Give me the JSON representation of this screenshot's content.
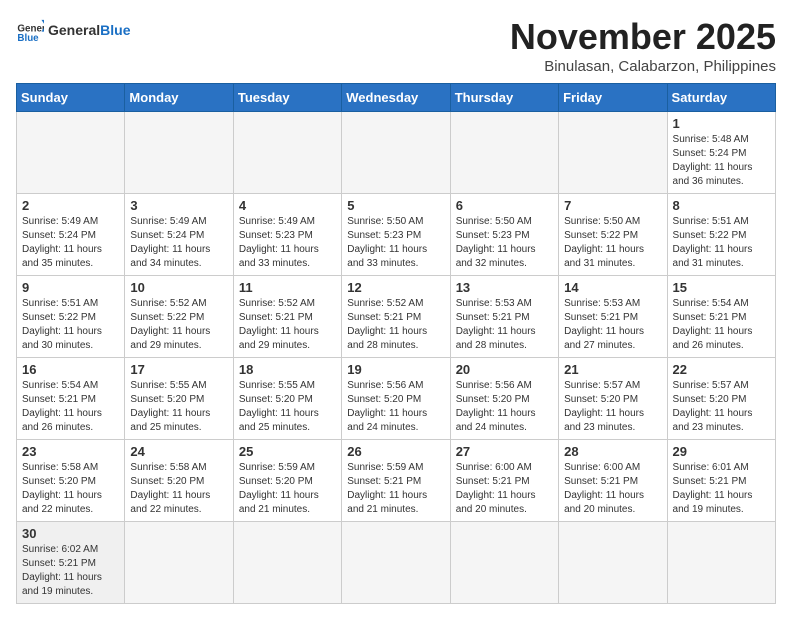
{
  "header": {
    "logo_general": "General",
    "logo_blue": "Blue",
    "month_title": "November 2025",
    "location": "Binulasan, Calabarzon, Philippines"
  },
  "weekdays": [
    "Sunday",
    "Monday",
    "Tuesday",
    "Wednesday",
    "Thursday",
    "Friday",
    "Saturday"
  ],
  "weeks": [
    [
      {
        "day": "",
        "info": ""
      },
      {
        "day": "",
        "info": ""
      },
      {
        "day": "",
        "info": ""
      },
      {
        "day": "",
        "info": ""
      },
      {
        "day": "",
        "info": ""
      },
      {
        "day": "",
        "info": ""
      },
      {
        "day": "1",
        "info": "Sunrise: 5:48 AM\nSunset: 5:24 PM\nDaylight: 11 hours\nand 36 minutes."
      }
    ],
    [
      {
        "day": "2",
        "info": "Sunrise: 5:49 AM\nSunset: 5:24 PM\nDaylight: 11 hours\nand 35 minutes."
      },
      {
        "day": "3",
        "info": "Sunrise: 5:49 AM\nSunset: 5:24 PM\nDaylight: 11 hours\nand 34 minutes."
      },
      {
        "day": "4",
        "info": "Sunrise: 5:49 AM\nSunset: 5:23 PM\nDaylight: 11 hours\nand 33 minutes."
      },
      {
        "day": "5",
        "info": "Sunrise: 5:50 AM\nSunset: 5:23 PM\nDaylight: 11 hours\nand 33 minutes."
      },
      {
        "day": "6",
        "info": "Sunrise: 5:50 AM\nSunset: 5:23 PM\nDaylight: 11 hours\nand 32 minutes."
      },
      {
        "day": "7",
        "info": "Sunrise: 5:50 AM\nSunset: 5:22 PM\nDaylight: 11 hours\nand 31 minutes."
      },
      {
        "day": "8",
        "info": "Sunrise: 5:51 AM\nSunset: 5:22 PM\nDaylight: 11 hours\nand 31 minutes."
      }
    ],
    [
      {
        "day": "9",
        "info": "Sunrise: 5:51 AM\nSunset: 5:22 PM\nDaylight: 11 hours\nand 30 minutes."
      },
      {
        "day": "10",
        "info": "Sunrise: 5:52 AM\nSunset: 5:22 PM\nDaylight: 11 hours\nand 29 minutes."
      },
      {
        "day": "11",
        "info": "Sunrise: 5:52 AM\nSunset: 5:21 PM\nDaylight: 11 hours\nand 29 minutes."
      },
      {
        "day": "12",
        "info": "Sunrise: 5:52 AM\nSunset: 5:21 PM\nDaylight: 11 hours\nand 28 minutes."
      },
      {
        "day": "13",
        "info": "Sunrise: 5:53 AM\nSunset: 5:21 PM\nDaylight: 11 hours\nand 28 minutes."
      },
      {
        "day": "14",
        "info": "Sunrise: 5:53 AM\nSunset: 5:21 PM\nDaylight: 11 hours\nand 27 minutes."
      },
      {
        "day": "15",
        "info": "Sunrise: 5:54 AM\nSunset: 5:21 PM\nDaylight: 11 hours\nand 26 minutes."
      }
    ],
    [
      {
        "day": "16",
        "info": "Sunrise: 5:54 AM\nSunset: 5:21 PM\nDaylight: 11 hours\nand 26 minutes."
      },
      {
        "day": "17",
        "info": "Sunrise: 5:55 AM\nSunset: 5:20 PM\nDaylight: 11 hours\nand 25 minutes."
      },
      {
        "day": "18",
        "info": "Sunrise: 5:55 AM\nSunset: 5:20 PM\nDaylight: 11 hours\nand 25 minutes."
      },
      {
        "day": "19",
        "info": "Sunrise: 5:56 AM\nSunset: 5:20 PM\nDaylight: 11 hours\nand 24 minutes."
      },
      {
        "day": "20",
        "info": "Sunrise: 5:56 AM\nSunset: 5:20 PM\nDaylight: 11 hours\nand 24 minutes."
      },
      {
        "day": "21",
        "info": "Sunrise: 5:57 AM\nSunset: 5:20 PM\nDaylight: 11 hours\nand 23 minutes."
      },
      {
        "day": "22",
        "info": "Sunrise: 5:57 AM\nSunset: 5:20 PM\nDaylight: 11 hours\nand 23 minutes."
      }
    ],
    [
      {
        "day": "23",
        "info": "Sunrise: 5:58 AM\nSunset: 5:20 PM\nDaylight: 11 hours\nand 22 minutes."
      },
      {
        "day": "24",
        "info": "Sunrise: 5:58 AM\nSunset: 5:20 PM\nDaylight: 11 hours\nand 22 minutes."
      },
      {
        "day": "25",
        "info": "Sunrise: 5:59 AM\nSunset: 5:20 PM\nDaylight: 11 hours\nand 21 minutes."
      },
      {
        "day": "26",
        "info": "Sunrise: 5:59 AM\nSunset: 5:21 PM\nDaylight: 11 hours\nand 21 minutes."
      },
      {
        "day": "27",
        "info": "Sunrise: 6:00 AM\nSunset: 5:21 PM\nDaylight: 11 hours\nand 20 minutes."
      },
      {
        "day": "28",
        "info": "Sunrise: 6:00 AM\nSunset: 5:21 PM\nDaylight: 11 hours\nand 20 minutes."
      },
      {
        "day": "29",
        "info": "Sunrise: 6:01 AM\nSunset: 5:21 PM\nDaylight: 11 hours\nand 19 minutes."
      }
    ],
    [
      {
        "day": "30",
        "info": "Sunrise: 6:02 AM\nSunset: 5:21 PM\nDaylight: 11 hours\nand 19 minutes."
      },
      {
        "day": "",
        "info": ""
      },
      {
        "day": "",
        "info": ""
      },
      {
        "day": "",
        "info": ""
      },
      {
        "day": "",
        "info": ""
      },
      {
        "day": "",
        "info": ""
      },
      {
        "day": "",
        "info": ""
      }
    ]
  ]
}
